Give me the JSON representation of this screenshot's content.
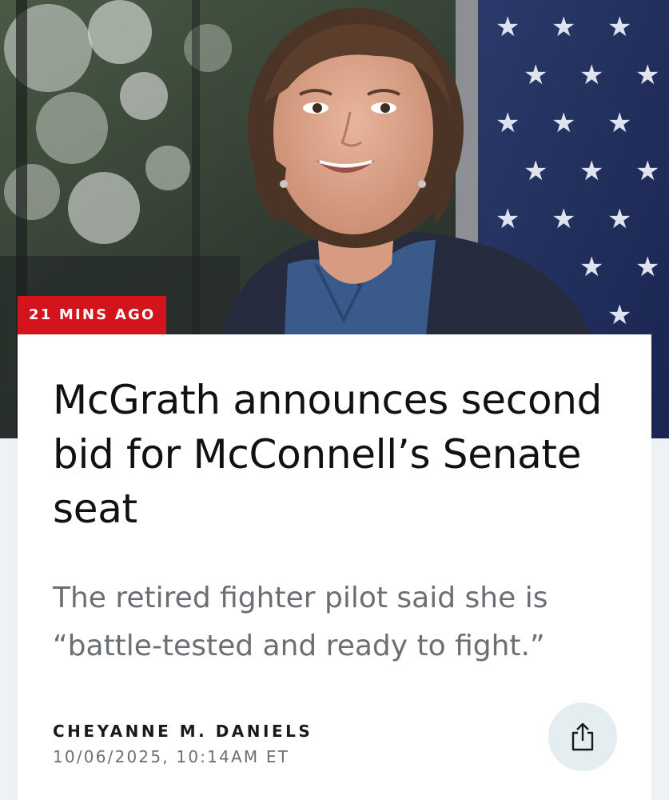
{
  "hero": {
    "image_name": "portrait of woman in front of american flag",
    "badge_text": "21 MINS AGO"
  },
  "article": {
    "headline": "McGrath announces second bid for McConnell’s Senate seat",
    "dek": "The retired fighter pilot said she is “battle-tested and ready to fight.”",
    "author": "CHEYANNE M. DANIELS",
    "timestamp": "10/06/2025, 10:14AM ET"
  },
  "actions": {
    "share_icon": "share-icon"
  },
  "colors": {
    "badge": "#d4141c",
    "headline": "#111111",
    "dek": "#6b6e72",
    "share_bg": "#e4edf0",
    "page_bg": "#eef2f4"
  }
}
